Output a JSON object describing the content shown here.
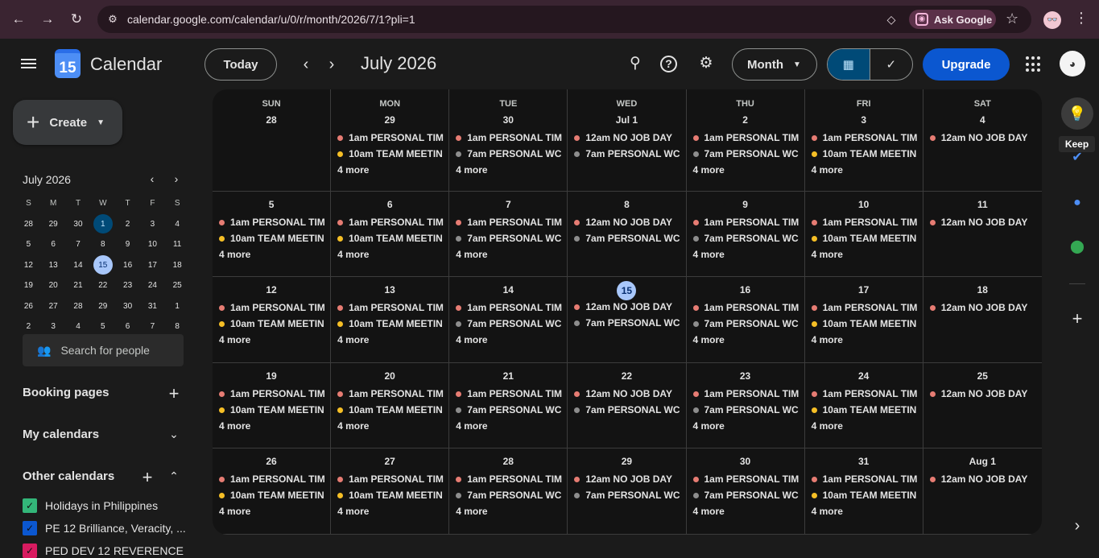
{
  "browser": {
    "url": "calendar.google.com/calendar/u/0/r/month/2026/7/1?pli=1",
    "ask_google": "Ask Google",
    "profile_initials": "👓"
  },
  "app": {
    "logo_text": "15",
    "title": "Calendar",
    "today_label": "Today",
    "month_title": "July 2026",
    "view_label": "Month",
    "upgrade_label": "Upgrade"
  },
  "sidebar": {
    "create_label": "Create",
    "mini_title": "July 2026",
    "mini_dow": [
      "S",
      "M",
      "T",
      "W",
      "T",
      "F",
      "S"
    ],
    "mini_weeks": [
      [
        "28",
        "29",
        "30",
        "1",
        "2",
        "3",
        "4"
      ],
      [
        "5",
        "6",
        "7",
        "8",
        "9",
        "10",
        "11"
      ],
      [
        "12",
        "13",
        "14",
        "15",
        "16",
        "17",
        "18"
      ],
      [
        "19",
        "20",
        "21",
        "22",
        "23",
        "24",
        "25"
      ],
      [
        "26",
        "27",
        "28",
        "29",
        "30",
        "31",
        "1"
      ],
      [
        "2",
        "3",
        "4",
        "5",
        "6",
        "7",
        "8"
      ]
    ],
    "search_people": "Search for people",
    "booking_pages": "Booking pages",
    "my_calendars": "My calendars",
    "other_calendars": "Other calendars",
    "calendars": [
      {
        "name": "Holidays in Philippines",
        "color": "#33b679"
      },
      {
        "name": "PE 12 Brilliance, Veracity, ...",
        "color": "#0b57d0"
      },
      {
        "name": "PED DEV 12 REVERENCE",
        "color": "#d81b60"
      }
    ]
  },
  "colors": {
    "personal_time": "#e67c73",
    "team_meeting": "#f6bf26",
    "personal_work": "#8d8d8d",
    "no_job_day": "#e67c73"
  },
  "weekdays": [
    "SUN",
    "MON",
    "TUE",
    "WED",
    "THU",
    "FRI",
    "SAT"
  ],
  "weeks": [
    [
      {
        "date": "28",
        "events": [],
        "more": ""
      },
      {
        "date": "29",
        "events": [
          {
            "text": "1am PERSONAL TIM",
            "color": "#e67c73"
          },
          {
            "text": "10am TEAM MEETIN",
            "color": "#f6bf26"
          }
        ],
        "more": "4 more"
      },
      {
        "date": "30",
        "events": [
          {
            "text": "1am PERSONAL TIM",
            "color": "#e67c73"
          },
          {
            "text": "7am PERSONAL WC",
            "color": "#8d8d8d"
          }
        ],
        "more": "4 more"
      },
      {
        "date": "Jul 1",
        "events": [
          {
            "text": "12am NO JOB DAY",
            "color": "#e67c73"
          },
          {
            "text": "7am PERSONAL WC",
            "color": "#8d8d8d"
          }
        ],
        "more": ""
      },
      {
        "date": "2",
        "events": [
          {
            "text": "1am PERSONAL TIM",
            "color": "#e67c73"
          },
          {
            "text": "7am PERSONAL WC",
            "color": "#8d8d8d"
          }
        ],
        "more": "4 more"
      },
      {
        "date": "3",
        "events": [
          {
            "text": "1am PERSONAL TIM",
            "color": "#e67c73"
          },
          {
            "text": "10am TEAM MEETIN",
            "color": "#f6bf26"
          }
        ],
        "more": "4 more"
      },
      {
        "date": "4",
        "events": [
          {
            "text": "12am NO JOB DAY",
            "color": "#e67c73"
          }
        ],
        "more": ""
      }
    ],
    [
      {
        "date": "5",
        "events": [
          {
            "text": "1am PERSONAL TIM",
            "color": "#e67c73"
          },
          {
            "text": "10am TEAM MEETIN",
            "color": "#f6bf26"
          }
        ],
        "more": "4 more"
      },
      {
        "date": "6",
        "events": [
          {
            "text": "1am PERSONAL TIM",
            "color": "#e67c73"
          },
          {
            "text": "10am TEAM MEETIN",
            "color": "#f6bf26"
          }
        ],
        "more": "4 more"
      },
      {
        "date": "7",
        "events": [
          {
            "text": "1am PERSONAL TIM",
            "color": "#e67c73"
          },
          {
            "text": "7am PERSONAL WC",
            "color": "#8d8d8d"
          }
        ],
        "more": "4 more"
      },
      {
        "date": "8",
        "events": [
          {
            "text": "12am NO JOB DAY",
            "color": "#e67c73"
          },
          {
            "text": "7am PERSONAL WC",
            "color": "#8d8d8d"
          }
        ],
        "more": ""
      },
      {
        "date": "9",
        "events": [
          {
            "text": "1am PERSONAL TIM",
            "color": "#e67c73"
          },
          {
            "text": "7am PERSONAL WC",
            "color": "#8d8d8d"
          }
        ],
        "more": "4 more"
      },
      {
        "date": "10",
        "events": [
          {
            "text": "1am PERSONAL TIM",
            "color": "#e67c73"
          },
          {
            "text": "10am TEAM MEETIN",
            "color": "#f6bf26"
          }
        ],
        "more": "4 more"
      },
      {
        "date": "11",
        "events": [
          {
            "text": "12am NO JOB DAY",
            "color": "#e67c73"
          }
        ],
        "more": ""
      }
    ],
    [
      {
        "date": "12",
        "events": [
          {
            "text": "1am PERSONAL TIM",
            "color": "#e67c73"
          },
          {
            "text": "10am TEAM MEETIN",
            "color": "#f6bf26"
          }
        ],
        "more": "4 more"
      },
      {
        "date": "13",
        "events": [
          {
            "text": "1am PERSONAL TIM",
            "color": "#e67c73"
          },
          {
            "text": "10am TEAM MEETIN",
            "color": "#f6bf26"
          }
        ],
        "more": "4 more"
      },
      {
        "date": "14",
        "events": [
          {
            "text": "1am PERSONAL TIM",
            "color": "#e67c73"
          },
          {
            "text": "7am PERSONAL WC",
            "color": "#8d8d8d"
          }
        ],
        "more": "4 more"
      },
      {
        "date": "15",
        "today": true,
        "events": [
          {
            "text": "12am NO JOB DAY",
            "color": "#e67c73"
          },
          {
            "text": "7am PERSONAL WC",
            "color": "#8d8d8d"
          }
        ],
        "more": ""
      },
      {
        "date": "16",
        "events": [
          {
            "text": "1am PERSONAL TIM",
            "color": "#e67c73"
          },
          {
            "text": "7am PERSONAL WC",
            "color": "#8d8d8d"
          }
        ],
        "more": "4 more"
      },
      {
        "date": "17",
        "events": [
          {
            "text": "1am PERSONAL TIM",
            "color": "#e67c73"
          },
          {
            "text": "10am TEAM MEETIN",
            "color": "#f6bf26"
          }
        ],
        "more": "4 more"
      },
      {
        "date": "18",
        "events": [
          {
            "text": "12am NO JOB DAY",
            "color": "#e67c73"
          }
        ],
        "more": ""
      }
    ],
    [
      {
        "date": "19",
        "events": [
          {
            "text": "1am PERSONAL TIM",
            "color": "#e67c73"
          },
          {
            "text": "10am TEAM MEETIN",
            "color": "#f6bf26"
          }
        ],
        "more": "4 more"
      },
      {
        "date": "20",
        "events": [
          {
            "text": "1am PERSONAL TIM",
            "color": "#e67c73"
          },
          {
            "text": "10am TEAM MEETIN",
            "color": "#f6bf26"
          }
        ],
        "more": "4 more"
      },
      {
        "date": "21",
        "events": [
          {
            "text": "1am PERSONAL TIM",
            "color": "#e67c73"
          },
          {
            "text": "7am PERSONAL WC",
            "color": "#8d8d8d"
          }
        ],
        "more": "4 more"
      },
      {
        "date": "22",
        "events": [
          {
            "text": "12am NO JOB DAY",
            "color": "#e67c73"
          },
          {
            "text": "7am PERSONAL WC",
            "color": "#8d8d8d"
          }
        ],
        "more": ""
      },
      {
        "date": "23",
        "events": [
          {
            "text": "1am PERSONAL TIM",
            "color": "#e67c73"
          },
          {
            "text": "7am PERSONAL WC",
            "color": "#8d8d8d"
          }
        ],
        "more": "4 more"
      },
      {
        "date": "24",
        "events": [
          {
            "text": "1am PERSONAL TIM",
            "color": "#e67c73"
          },
          {
            "text": "10am TEAM MEETIN",
            "color": "#f6bf26"
          }
        ],
        "more": "4 more"
      },
      {
        "date": "25",
        "events": [
          {
            "text": "12am NO JOB DAY",
            "color": "#e67c73"
          }
        ],
        "more": ""
      }
    ],
    [
      {
        "date": "26",
        "events": [
          {
            "text": "1am PERSONAL TIM",
            "color": "#e67c73"
          },
          {
            "text": "10am TEAM MEETIN",
            "color": "#f6bf26"
          }
        ],
        "more": "4 more"
      },
      {
        "date": "27",
        "events": [
          {
            "text": "1am PERSONAL TIM",
            "color": "#e67c73"
          },
          {
            "text": "10am TEAM MEETIN",
            "color": "#f6bf26"
          }
        ],
        "more": "4 more"
      },
      {
        "date": "28",
        "events": [
          {
            "text": "1am PERSONAL TIM",
            "color": "#e67c73"
          },
          {
            "text": "7am PERSONAL WC",
            "color": "#8d8d8d"
          }
        ],
        "more": "4 more"
      },
      {
        "date": "29",
        "events": [
          {
            "text": "12am NO JOB DAY",
            "color": "#e67c73"
          },
          {
            "text": "7am PERSONAL WC",
            "color": "#8d8d8d"
          }
        ],
        "more": ""
      },
      {
        "date": "30",
        "events": [
          {
            "text": "1am PERSONAL TIM",
            "color": "#e67c73"
          },
          {
            "text": "7am PERSONAL WC",
            "color": "#8d8d8d"
          }
        ],
        "more": "4 more"
      },
      {
        "date": "31",
        "events": [
          {
            "text": "1am PERSONAL TIM",
            "color": "#e67c73"
          },
          {
            "text": "10am TEAM MEETIN",
            "color": "#f6bf26"
          }
        ],
        "more": "4 more"
      },
      {
        "date": "Aug 1",
        "events": [
          {
            "text": "12am NO JOB DAY",
            "color": "#e67c73"
          }
        ],
        "more": ""
      }
    ]
  ],
  "side_panel": {
    "keep_tooltip": "Keep"
  }
}
